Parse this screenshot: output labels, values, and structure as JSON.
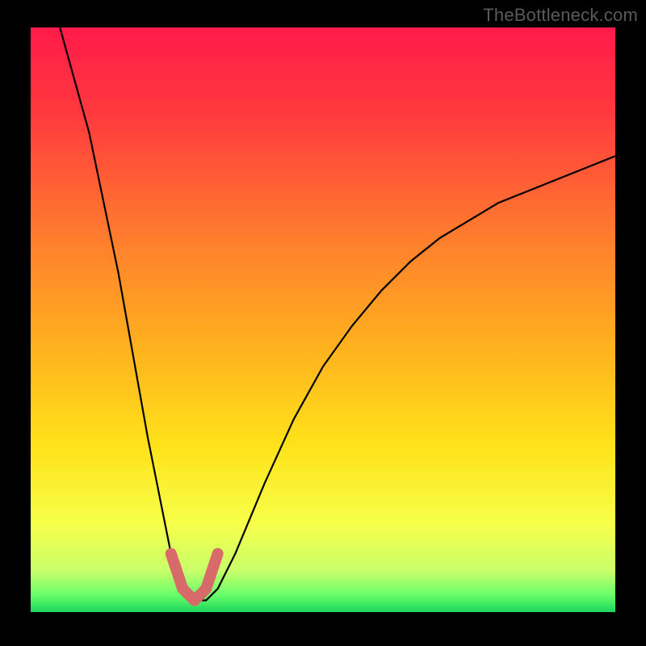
{
  "watermark": "TheBottleneck.com",
  "accent": {
    "curve": "#000000",
    "highlight": "#d96a6a",
    "green_band": "#2bd66a"
  },
  "chart_data": {
    "type": "line",
    "title": "",
    "xlabel": "",
    "ylabel": "",
    "xlim": [
      0,
      100
    ],
    "ylim": [
      0,
      100
    ],
    "grid": false,
    "series": [
      {
        "name": "bottleneck-curve",
        "x": [
          5,
          10,
          15,
          20,
          24,
          26,
          28,
          30,
          32,
          35,
          40,
          45,
          50,
          55,
          60,
          65,
          70,
          75,
          80,
          85,
          90,
          95,
          100
        ],
        "y": [
          100,
          82,
          58,
          30,
          10,
          4,
          2,
          2,
          4,
          10,
          22,
          33,
          42,
          49,
          55,
          60,
          64,
          67,
          70,
          72,
          74,
          76,
          78
        ]
      },
      {
        "name": "optimal-range-highlight",
        "x": [
          24,
          26,
          28,
          30,
          32
        ],
        "y": [
          10,
          4,
          2,
          4,
          10
        ]
      }
    ],
    "background_gradient": {
      "stops": [
        {
          "pos": 0.0,
          "color": "#ff1a4a"
        },
        {
          "pos": 0.15,
          "color": "#ff3a3e"
        },
        {
          "pos": 0.35,
          "color": "#ff7a2e"
        },
        {
          "pos": 0.55,
          "color": "#ffb21e"
        },
        {
          "pos": 0.72,
          "color": "#ffe31a"
        },
        {
          "pos": 0.85,
          "color": "#f6ff4a"
        },
        {
          "pos": 0.93,
          "color": "#c8ff6a"
        },
        {
          "pos": 0.97,
          "color": "#6aff6a"
        },
        {
          "pos": 1.0,
          "color": "#1cd65c"
        }
      ]
    }
  }
}
